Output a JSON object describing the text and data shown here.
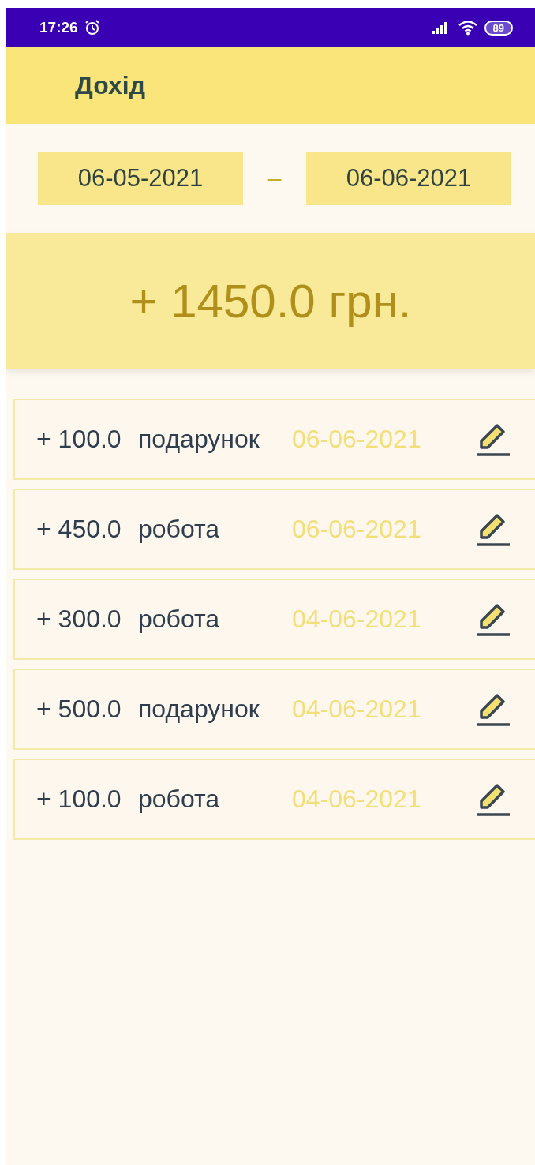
{
  "status_bar": {
    "time": "17:26",
    "battery": "89"
  },
  "app_bar": {
    "title": "Дохід"
  },
  "date_range": {
    "from": "06-05-2021",
    "separator": "–",
    "to": "06-06-2021"
  },
  "total": "+ 1450.0 грн.",
  "entries": [
    {
      "amount": "+ 100.0",
      "category": "подарунок",
      "date": "06-06-2021"
    },
    {
      "amount": "+ 450.0",
      "category": "робота",
      "date": "06-06-2021"
    },
    {
      "amount": "+ 300.0",
      "category": "робота",
      "date": "04-06-2021"
    },
    {
      "amount": "+ 500.0",
      "category": "подарунок",
      "date": "04-06-2021"
    },
    {
      "amount": "+ 100.0",
      "category": "робота",
      "date": "04-06-2021"
    }
  ]
}
